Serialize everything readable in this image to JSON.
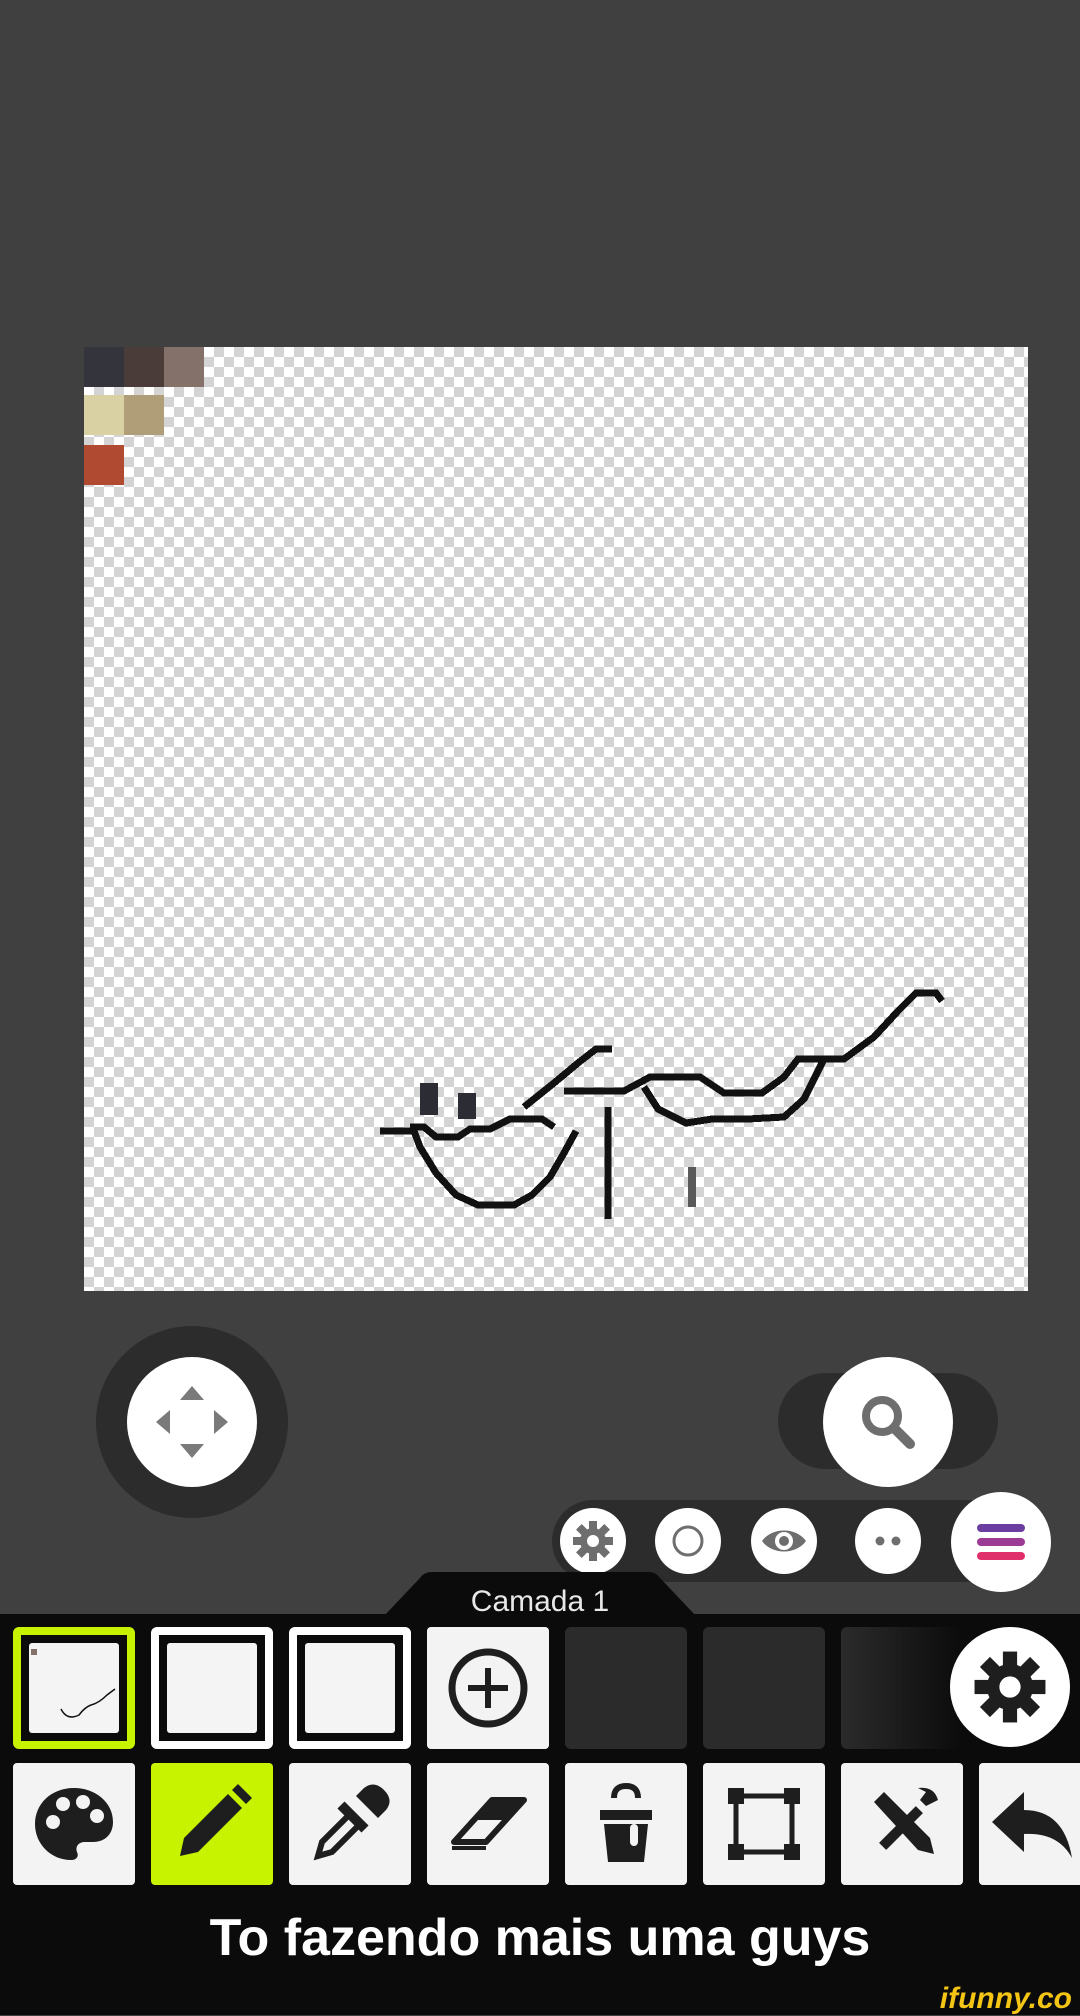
{
  "palette": {
    "colors": [
      "#34343c",
      "#4a3c38",
      "#84726a",
      "#d9d0a4",
      "#b09e78",
      "#b04a30"
    ]
  },
  "controls": {
    "move_icon": "move-arrows-icon",
    "zoom_icon": "magnifier-icon"
  },
  "quickbar": {
    "items": [
      "gear-icon",
      "circle-icon",
      "eye-icon",
      "dots-icon"
    ],
    "menu_icon": "hamburger-menu-icon"
  },
  "layers": {
    "current_label": "Camada 1",
    "slots": [
      {
        "state": "selected",
        "has_drawing": true
      },
      {
        "state": "empty"
      },
      {
        "state": "empty"
      },
      {
        "state": "add"
      },
      {
        "state": "inactive"
      },
      {
        "state": "inactive"
      },
      {
        "state": "inactive"
      }
    ],
    "settings_icon": "gear-icon"
  },
  "toolbar": {
    "tools": [
      "palette-icon",
      "pencil-icon",
      "eyedropper-icon",
      "eraser-icon",
      "bucket-icon",
      "select-frame-icon",
      "tools-icon",
      "undo-icon"
    ],
    "active_tool": "pencil-icon",
    "active_color": "#c7f200"
  },
  "caption": {
    "text": "To fazendo mais uma guys"
  },
  "watermark": {
    "text": "ifunny.co"
  }
}
